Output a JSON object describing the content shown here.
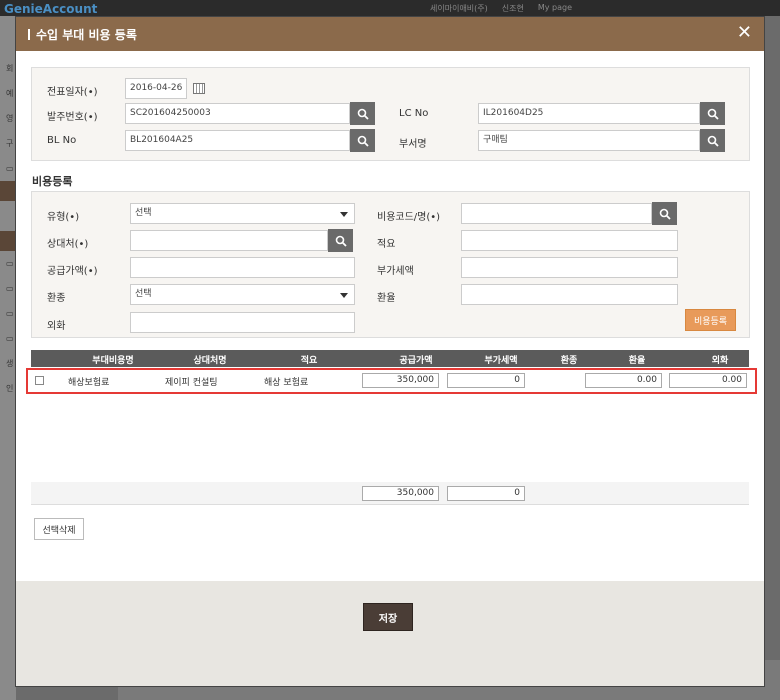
{
  "background": {
    "app_logo": "GenieAccount",
    "top_right": [
      "세이마이애비(주)",
      "신조현",
      "My page"
    ]
  },
  "modal": {
    "title": "수입 부대 비용 등록",
    "close_glyph": "✕"
  },
  "header_form": {
    "doc_date_label": "전표일자(•)",
    "doc_date_value": "2016-04-26",
    "order_no_label": "발주번호(•)",
    "order_no_value": "SC201604250003",
    "lc_no_label": "LC No",
    "lc_no_value": "IL201604D25",
    "bl_no_label": "BL No",
    "bl_no_value": "BL201604A25",
    "dept_label": "부서명",
    "dept_value": "구매팀"
  },
  "cost_section": {
    "title": "비용등록",
    "type_label": "유형(•)",
    "type_value": "선택",
    "cost_code_label": "비용코드/명(•)",
    "cost_code_value": "",
    "partner_label": "상대처(•)",
    "partner_value": "",
    "summary_label": "적요",
    "summary_value": "",
    "supply_amount_label": "공급가액(•)",
    "supply_amount_value": "",
    "vat_label": "부가세액",
    "vat_value": "",
    "currency_label": "환종",
    "currency_value": "선택",
    "rate_label": "환율",
    "rate_value": "",
    "foreign_label": "외화",
    "foreign_value": "",
    "register_button": "비용등록"
  },
  "table": {
    "headers": [
      "부대비용명",
      "상대처명",
      "적요",
      "공급가액",
      "부가세액",
      "환종",
      "환율",
      "외화"
    ],
    "rows": [
      {
        "cost_name": "해상보험료",
        "partner": "제이피 컨설팅",
        "summary": "해상 보험료",
        "supply_amount": "350,000",
        "vat": "0",
        "currency": "",
        "rate": "0.00",
        "foreign": "0.00"
      }
    ],
    "totals": {
      "supply_amount": "350,000",
      "vat": "0"
    }
  },
  "buttons": {
    "delete_selected": "선택삭제",
    "save": "저장"
  },
  "colors": {
    "header_brown": "#8b6a4b",
    "accent_orange": "#e89a5a",
    "save_dark": "#4a3d36",
    "highlight_red": "#e53935"
  }
}
